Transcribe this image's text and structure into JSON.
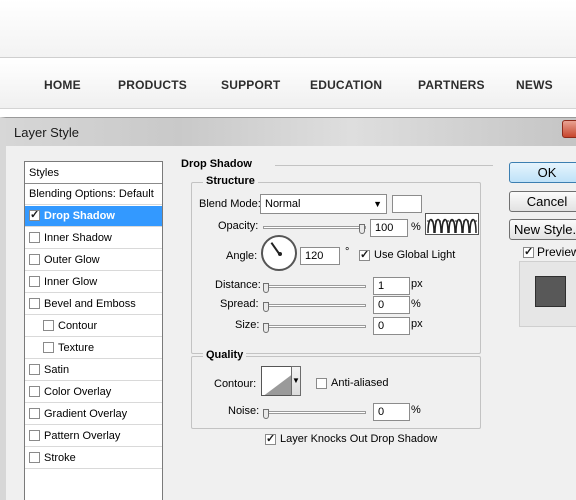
{
  "site": {
    "nav": [
      "HOME",
      "PRODUCTS",
      "SUPPORT",
      "EDUCATION",
      "PARTNERS",
      "NEWS"
    ]
  },
  "dialog": {
    "title": "Layer Style",
    "styles_header": "Styles",
    "style_items": [
      {
        "label": "Blending Options: Default",
        "checkbox": false,
        "checked": false,
        "selected": false,
        "indent": 0
      },
      {
        "label": "Drop Shadow",
        "checkbox": true,
        "checked": true,
        "selected": true,
        "indent": 0
      },
      {
        "label": "Inner Shadow",
        "checkbox": true,
        "checked": false,
        "selected": false,
        "indent": 0
      },
      {
        "label": "Outer Glow",
        "checkbox": true,
        "checked": false,
        "selected": false,
        "indent": 0
      },
      {
        "label": "Inner Glow",
        "checkbox": true,
        "checked": false,
        "selected": false,
        "indent": 0
      },
      {
        "label": "Bevel and Emboss",
        "checkbox": true,
        "checked": false,
        "selected": false,
        "indent": 0
      },
      {
        "label": "Contour",
        "checkbox": true,
        "checked": false,
        "selected": false,
        "indent": 1
      },
      {
        "label": "Texture",
        "checkbox": true,
        "checked": false,
        "selected": false,
        "indent": 1
      },
      {
        "label": "Satin",
        "checkbox": true,
        "checked": false,
        "selected": false,
        "indent": 0
      },
      {
        "label": "Color Overlay",
        "checkbox": true,
        "checked": false,
        "selected": false,
        "indent": 0
      },
      {
        "label": "Gradient Overlay",
        "checkbox": true,
        "checked": false,
        "selected": false,
        "indent": 0
      },
      {
        "label": "Pattern Overlay",
        "checkbox": true,
        "checked": false,
        "selected": false,
        "indent": 0
      },
      {
        "label": "Stroke",
        "checkbox": true,
        "checked": false,
        "selected": false,
        "indent": 0
      }
    ],
    "drop_shadow": {
      "section_title": "Drop Shadow",
      "structure_title": "Structure",
      "blend_mode_label": "Blend Mode:",
      "blend_mode_value": "Normal",
      "opacity_label": "Opacity:",
      "opacity_value": "100",
      "opacity_unit": "%",
      "angle_label": "Angle:",
      "angle_value": "120",
      "angle_unit": "°",
      "use_global_light_label": "Use Global Light",
      "use_global_light_checked": true,
      "distance_label": "Distance:",
      "distance_value": "1",
      "distance_unit": "px",
      "spread_label": "Spread:",
      "spread_value": "0",
      "spread_unit": "%",
      "size_label": "Size:",
      "size_value": "0",
      "size_unit": "px",
      "quality_title": "Quality",
      "contour_label": "Contour:",
      "anti_aliased_label": "Anti-aliased",
      "anti_aliased_checked": false,
      "noise_label": "Noise:",
      "noise_value": "0",
      "noise_unit": "%",
      "knockout_label": "Layer Knocks Out Drop Shadow",
      "knockout_checked": true
    },
    "buttons": {
      "ok": "OK",
      "cancel": "Cancel",
      "new_style": "New Style...",
      "preview_label": "Preview",
      "preview_checked": true
    },
    "colors": {
      "selected_row": "#3399ff",
      "shadow_color": "#ffffff",
      "preview_swatch": "#585858"
    }
  }
}
